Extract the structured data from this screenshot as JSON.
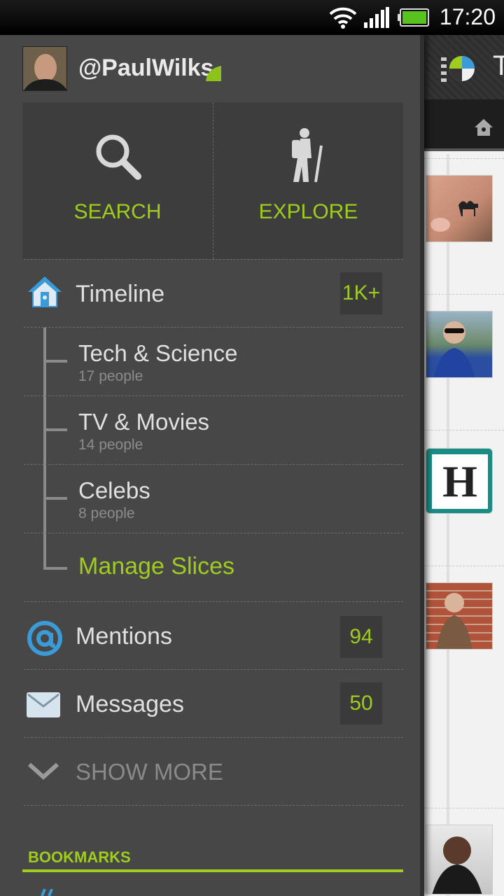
{
  "status_bar": {
    "time": "17:20"
  },
  "profile": {
    "username": "@PaulWilks"
  },
  "tiles": [
    {
      "label": "SEARCH",
      "icon": "search-icon"
    },
    {
      "label": "EXPLORE",
      "icon": "hiker-icon"
    }
  ],
  "nav": {
    "timeline": {
      "label": "Timeline",
      "badge": "1K+",
      "icon": "home-icon"
    },
    "slices": [
      {
        "title": "Tech & Science",
        "meta": "17 people"
      },
      {
        "title": "TV & Movies",
        "meta": "14 people"
      },
      {
        "title": "Celebs",
        "meta": "8 people"
      }
    ],
    "manage_slices": "Manage Slices",
    "mentions": {
      "label": "Mentions",
      "badge": "94",
      "icon": "at-icon"
    },
    "messages": {
      "label": "Messages",
      "badge": "50",
      "icon": "envelope-icon"
    },
    "show_more": "SHOW MORE"
  },
  "section": {
    "bookmarks": "BOOKMARKS"
  },
  "background_app": {
    "title_fragment": "T",
    "thumb_h_letter": "H"
  },
  "colors": {
    "accent": "#9fcc1e",
    "drawer_bg": "#474747",
    "icon_blue": "#3a9bd8"
  }
}
